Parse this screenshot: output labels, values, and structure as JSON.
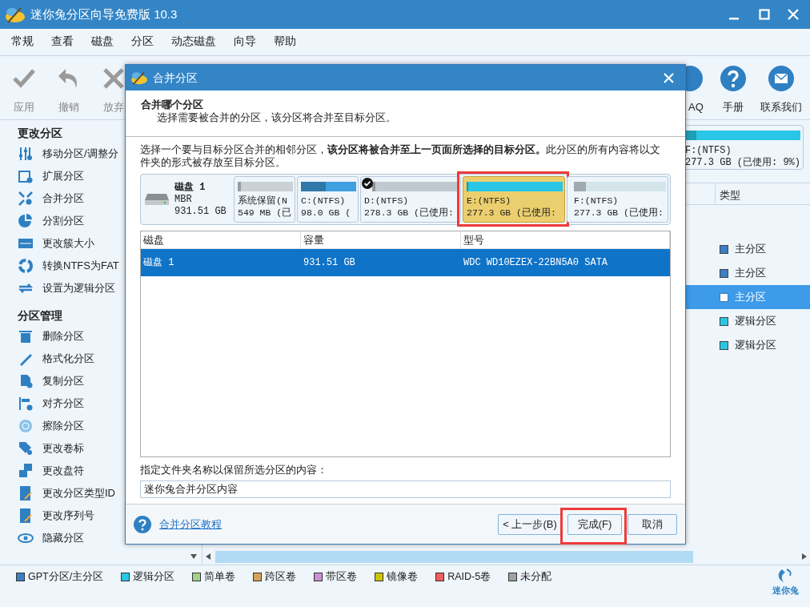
{
  "window": {
    "title": "迷你兔分区向导免费版 10.3"
  },
  "menu": [
    "常规",
    "查看",
    "磁盘",
    "分区",
    "动态磁盘",
    "向导",
    "帮助"
  ],
  "toolbar": {
    "left": [
      {
        "label": "应用",
        "disabled": true
      },
      {
        "label": "撤销",
        "disabled": true
      },
      {
        "label": "放弃",
        "disabled": true
      }
    ],
    "right": [
      {
        "label": "AQ"
      },
      {
        "label": "手册"
      },
      {
        "label": "联系我们"
      }
    ]
  },
  "sidebar": [
    {
      "title": "更改分区",
      "items": [
        "移动分区/调整分",
        "扩展分区",
        "合并分区",
        "分割分区",
        "更改簇大小",
        "转换NTFS为FAT",
        "设置为逻辑分区"
      ]
    },
    {
      "title": "分区管理",
      "items": [
        "删除分区",
        "格式化分区",
        "复制分区",
        "对齐分区",
        "擦除分区",
        "更改卷标",
        "更改盘符",
        "更改分区类型ID",
        "更改序列号",
        "隐藏分区"
      ]
    }
  ],
  "disk_map": {
    "label": "F:(NTFS)",
    "detail": "277.3 GB (已使用: 9%)",
    "level": 0.1,
    "color": "#29c6e6"
  },
  "partition_list": {
    "columns": [
      "类型"
    ],
    "rows": [
      {
        "type": "主分区",
        "color": "#3a7fc4",
        "selected": false
      },
      {
        "type": "主分区",
        "color": "#3a7fc4",
        "selected": false
      },
      {
        "type": "主分区",
        "color": "#3a7fc4",
        "selected": true
      },
      {
        "type": "逻辑分区",
        "color": "#29c6e6",
        "selected": false
      },
      {
        "type": "逻辑分区",
        "color": "#29c6e6",
        "selected": false
      }
    ]
  },
  "dialog": {
    "title": "合并分区",
    "heading": "合并哪个分区",
    "subheading": "选择需要被合并的分区，该分区将合并至目标分区。",
    "instruction": "选择一个要与目标分区合并的相邻分区，**该分区将被合并至上一页面所选择的目标分区。**此分区的所有内容将以文件夹的形式被存放至目标分区。",
    "disk": {
      "name": "磁盘 1",
      "scheme": "MBR",
      "size": "931.51 GB"
    },
    "partitions": [
      {
        "name": "系统保留(N",
        "size": "549 MB (已",
        "level": 0.06,
        "color": "#c9d1d7",
        "selected": false,
        "checked": false
      },
      {
        "name": "C:(NTFS)",
        "size": "98.0 GB (",
        "level": 0.45,
        "color": "#3fa0e0",
        "selected": false,
        "checked": false
      },
      {
        "name": "D:(NTFS)",
        "size": "278.3 GB (已使用:",
        "level": 0.04,
        "color": "#c0c9d0",
        "selected": false,
        "checked": true
      },
      {
        "name": "E:(NTFS)",
        "size": "277.3 GB (已使用:",
        "level": 0.02,
        "color": "#29c6e6",
        "selected": true,
        "checked": false
      },
      {
        "name": "F:(NTFS)",
        "size": "277.3 GB (已使用:",
        "level": 0.13,
        "color": "#d4e5ea",
        "selected": false,
        "checked": false
      }
    ],
    "table": {
      "columns": [
        "磁盘",
        "容量",
        "型号"
      ],
      "rows": [
        {
          "cells": [
            "磁盘 1",
            "931.51 GB",
            "WDC WD10EZEX-22BN5A0 SATA"
          ],
          "selected": true
        }
      ]
    },
    "folder_label": "指定文件夹名称以保留所选分区的内容：",
    "folder_value": "迷你兔合并分区内容",
    "help_link": "合并分区教程",
    "buttons": [
      {
        "label": "< 上一步(B)",
        "highlighted": false
      },
      {
        "label": "完成(F)",
        "highlighted": true
      },
      {
        "label": "取消",
        "highlighted": false
      }
    ]
  },
  "legend": [
    {
      "label": "GPT分区/主分区",
      "color": "#3a7fc4"
    },
    {
      "label": "逻辑分区",
      "color": "#29c6e6"
    },
    {
      "label": "简单卷",
      "color": "#a3d08a"
    },
    {
      "label": "跨区卷",
      "color": "#d6a25c"
    },
    {
      "label": "带区卷",
      "color": "#c990d6"
    },
    {
      "label": "镜像卷",
      "color": "#cdc400"
    },
    {
      "label": "RAID-5卷",
      "color": "#ef5d5d"
    },
    {
      "label": "未分配",
      "color": "#a0a0a0"
    }
  ],
  "logo": "迷你兔"
}
